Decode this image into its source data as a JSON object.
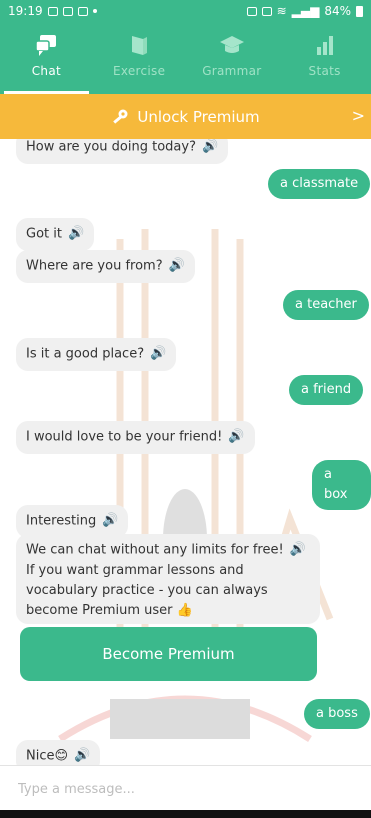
{
  "status": {
    "time": "19:19",
    "battery": "84%"
  },
  "tabs": [
    {
      "label": "Chat",
      "icon": "chat-icon",
      "active": true
    },
    {
      "label": "Exercise",
      "icon": "exercise-icon",
      "active": false
    },
    {
      "label": "Grammar",
      "icon": "grammar-icon",
      "active": false
    },
    {
      "label": "Stats",
      "icon": "stats-icon",
      "active": false
    }
  ],
  "premium_bar": {
    "label": "Unlock Premium",
    "icon": "key-icon",
    "chevron": ">"
  },
  "messages": [
    {
      "from": "bot",
      "text": "How are you doing today?"
    },
    {
      "from": "user",
      "text": "a classmate"
    },
    {
      "from": "bot",
      "text": "Got it"
    },
    {
      "from": "bot",
      "text": "Where are you from?"
    },
    {
      "from": "user",
      "text": "a teacher"
    },
    {
      "from": "bot",
      "text": "Is it a good place?"
    },
    {
      "from": "user",
      "text": "a friend"
    },
    {
      "from": "bot",
      "text": "I would love to be your friend!"
    },
    {
      "from": "user",
      "text": "a box"
    },
    {
      "from": "bot",
      "text": "Interesting"
    },
    {
      "from": "bot",
      "lines": [
        "We can chat without any limits for free!",
        "If you want grammar lessons and",
        "vocabulary practice - you can always",
        "become Premium user"
      ],
      "emoji": "👍"
    },
    {
      "from": "user",
      "text": "a boss"
    },
    {
      "from": "bot",
      "text": "Nice",
      "emoji": "😊"
    }
  ],
  "cta": {
    "label": "Become Premium"
  },
  "composer": {
    "placeholder": "Type a message..."
  },
  "colors": {
    "primary": "#3bb98c",
    "premium": "#f6b93b",
    "bubble": "#f0f0f0"
  }
}
